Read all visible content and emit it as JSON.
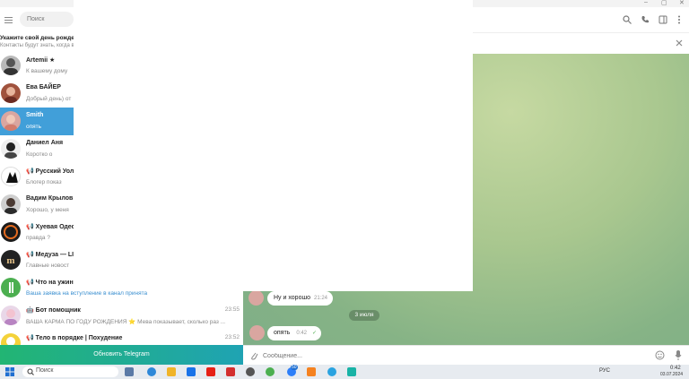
{
  "window": {
    "minimize": "–",
    "maximize": "▢",
    "close": "✕"
  },
  "sidebar": {
    "search_placeholder": "Поиск",
    "birthday_title": "Укажите свой день рожде",
    "birthday_subtitle": "Контакты будут знать, когда в",
    "chats": [
      {
        "name": "Artemii ★",
        "preview": "К вашему дому",
        "time": ""
      },
      {
        "name": "Ева БАЙЕР",
        "preview": "Добрый день) от",
        "time": ""
      },
      {
        "name": "Smith",
        "preview": "опять",
        "time": ""
      },
      {
        "name": "Даниел Аня",
        "preview": "Коротко о",
        "time": ""
      },
      {
        "name": "📢 Русский Уолл",
        "preview": "Блогер показ",
        "time": ""
      },
      {
        "name": "Вадим Крылов",
        "preview": "Хорошо, у меня",
        "time": ""
      },
      {
        "name": "📢 Хуевая Одесс",
        "preview": "правда ?",
        "time": ""
      },
      {
        "name": "📢 Медуза — LIV",
        "preview": "Главные новост",
        "time": ""
      },
      {
        "name": "📢 Что на ужин?",
        "preview": "Ваша заявка на вступление в канал принята",
        "time": ""
      },
      {
        "name": "🤖 Бот помощник",
        "preview": "ВАША КАРМА ПО ГОДУ РОЖДЕНИЯ ⭐ Мева показывает, сколько раз ...",
        "time": "23:55"
      },
      {
        "name": "📢 Тело в порядке | Похудение",
        "preview": "",
        "time": "23:52"
      }
    ],
    "update_button": "Обновить Telegram"
  },
  "messages": [
    {
      "text": "Ну и хорошо",
      "time": "21:24"
    },
    {
      "text": "опять",
      "time": "0:42"
    }
  ],
  "date_chip": "3 июля",
  "composer": {
    "placeholder": "Сообщение..."
  },
  "taskbar": {
    "search_placeholder": "Поиск",
    "lang": "РУС",
    "time": "0:42",
    "date": "03.07.2024",
    "badge": "50"
  },
  "colors": {
    "accent": "#419fd9",
    "update_gradient_start": "#22b573",
    "update_gradient_end": "#1fa3b3"
  }
}
